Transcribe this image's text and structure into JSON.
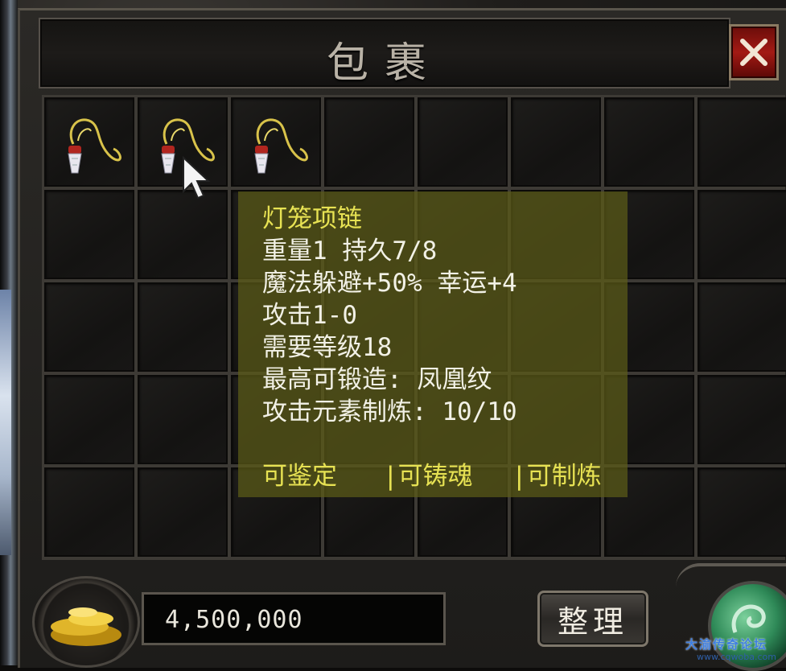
{
  "window": {
    "title": "包裹",
    "close_icon": "close-x-icon"
  },
  "inventory": {
    "columns": 8,
    "rows": 5,
    "items": [
      {
        "slot": 0,
        "icon": "lantern-necklace-icon"
      },
      {
        "slot": 1,
        "icon": "lantern-necklace-icon"
      },
      {
        "slot": 2,
        "icon": "lantern-necklace-icon"
      }
    ]
  },
  "tooltip": {
    "name": "灯笼项链",
    "lines": [
      "重量1 持久7/8",
      "魔法躲避+50% 幸运+4",
      "攻击1-0",
      "需要等级18",
      "最高可锻造: 凤凰纹",
      "攻击元素制炼: 10/10"
    ],
    "flags": [
      "可鉴定",
      "|可铸魂",
      "|可制炼"
    ]
  },
  "footer": {
    "gold_amount": "4,500,000",
    "gold_icon": "gold-pile-icon",
    "sort_label": "整理",
    "orb_icon": "jade-orb-icon"
  },
  "watermark": {
    "text": "大渝传奇论坛",
    "sub": "www.cqwoba.com"
  },
  "colors": {
    "tooltip_name": "#e7e253",
    "tooltip_text": "#f2f1e6",
    "close_button": "#a31a14",
    "watermark": "#3f7fe0"
  }
}
